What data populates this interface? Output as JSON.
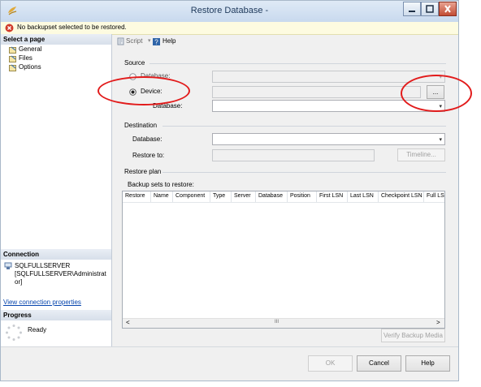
{
  "window": {
    "title": "Restore Database -"
  },
  "error_bar": {
    "message": "No backupset selected to be restored."
  },
  "left_pane": {
    "select_page_header": "Select a page",
    "pages": [
      {
        "label": "General"
      },
      {
        "label": "Files"
      },
      {
        "label": "Options"
      }
    ],
    "connection_header": "Connection",
    "connection_server": "SQLFULLSERVER",
    "connection_user_line1": "[SQLFULLSERVER\\Administrat",
    "connection_user_line2": "or]",
    "view_connection_link": "View connection properties",
    "progress_header": "Progress",
    "progress_status": "Ready"
  },
  "toolbar": {
    "script_label": "Script",
    "help_label": "Help"
  },
  "source": {
    "group_label": "Source",
    "database_radio_label": "Database:",
    "device_radio_label": "Device:",
    "selected": "Device",
    "browse_label": "...",
    "database_label": "Database:",
    "database_value": ""
  },
  "destination": {
    "group_label": "Destination",
    "database_label": "Database:",
    "database_value": "",
    "restore_to_label": "Restore to:",
    "restore_to_value": "",
    "timeline_label": "Timeline..."
  },
  "restore_plan": {
    "group_label": "Restore plan",
    "sets_label": "Backup sets to restore:",
    "columns": [
      "Restore",
      "Name",
      "Component",
      "Type",
      "Server",
      "Database",
      "Position",
      "First LSN",
      "Last LSN",
      "Checkpoint LSN",
      "Full LS"
    ],
    "rows": []
  },
  "verify_label": "Verify Backup Media",
  "footer": {
    "ok_label": "OK",
    "cancel_label": "Cancel",
    "help_label": "Help"
  },
  "colors": {
    "annotation": "#e21b1b",
    "link": "#0645ad",
    "error": "#c62828"
  }
}
